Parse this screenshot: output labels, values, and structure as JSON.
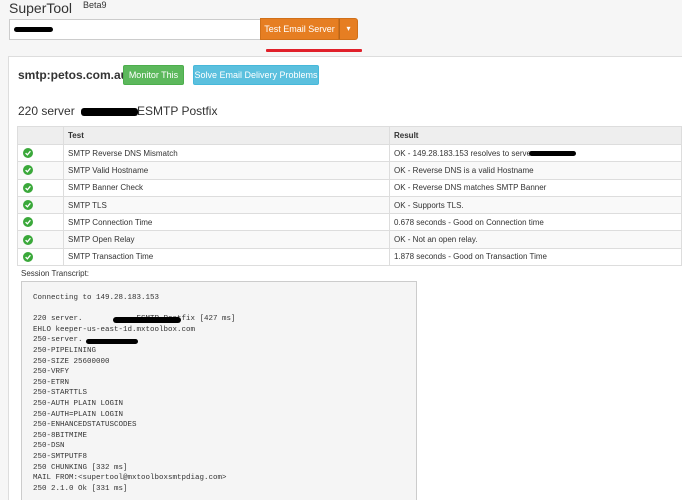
{
  "header": {
    "title": "SuperTool",
    "beta": "Beta9"
  },
  "search": {
    "value": "",
    "primary_button": "Test Email Server",
    "caret": "▾"
  },
  "result": {
    "host": "smtp:petos.com.au",
    "monitor_button": "Monitor This",
    "solve_button": "Solve Email Delivery Problems",
    "banner_prefix": "220 server",
    "banner_suffix": "ESMTP Postfix"
  },
  "table": {
    "headers": [
      "",
      "Test",
      "Result"
    ],
    "rows": [
      {
        "status": "pass",
        "test": "SMTP Reverse DNS Mismatch",
        "result": "OK - 149.28.183.153 resolves to server."
      },
      {
        "status": "pass",
        "test": "SMTP Valid Hostname",
        "result": "OK - Reverse DNS is a valid Hostname"
      },
      {
        "status": "pass",
        "test": "SMTP Banner Check",
        "result": "OK - Reverse DNS matches SMTP Banner"
      },
      {
        "status": "pass",
        "test": "SMTP TLS",
        "result": "OK - Supports TLS."
      },
      {
        "status": "pass",
        "test": "SMTP Connection Time",
        "result": "0.678 seconds - Good on Connection time"
      },
      {
        "status": "pass",
        "test": "SMTP Open Relay",
        "result": "OK - Not an open relay."
      },
      {
        "status": "pass",
        "test": "SMTP Transaction Time",
        "result": "1.878 seconds - Good on Transaction Time"
      }
    ]
  },
  "transcript": {
    "label": "Session Transcript:",
    "lines": [
      "Connecting to 149.28.183.153",
      "",
      "220 server.            ESMTP Postfix [427 ms]",
      "EHLO keeper-us-east-1d.mxtoolbox.com",
      "250-server.",
      "250-PIPELINING",
      "250-SIZE 25600000",
      "250-VRFY",
      "250-ETRN",
      "250-STARTTLS",
      "250-AUTH PLAIN LOGIN",
      "250-AUTH=PLAIN LOGIN",
      "250-ENHANCEDSTATUSCODES",
      "250-8BITMIME",
      "250-DSN",
      "250-SMTPUTF8",
      "250 CHUNKING [332 ms]",
      "MAIL FROM:<supertool@mxtoolboxsmtpdiag.com>",
      "250 2.1.0 Ok [331 ms]"
    ]
  },
  "colors": {
    "orange": "#e67e22",
    "green": "#5cb85c",
    "blue": "#5bc0de",
    "red_mark": "#e0202a"
  }
}
